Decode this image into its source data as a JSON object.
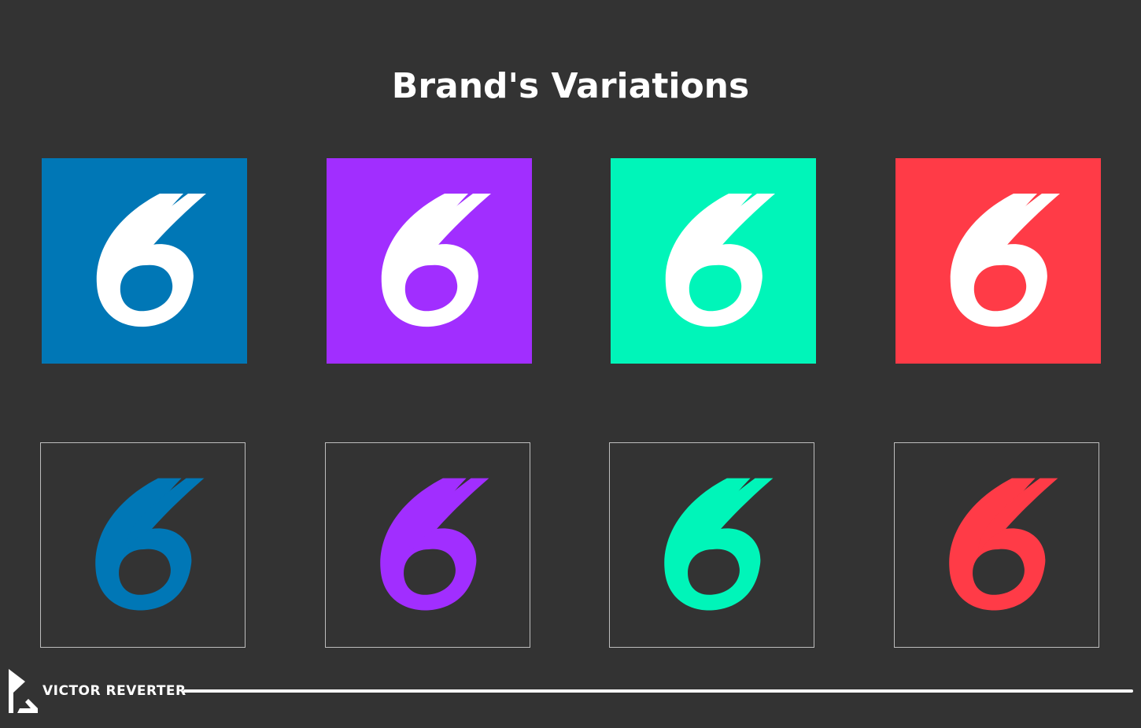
{
  "title": "Brand's Variations",
  "variations": [
    {
      "color": "#0077b6",
      "name": "blue"
    },
    {
      "color": "#a12eff",
      "name": "purple"
    },
    {
      "color": "#00f5b9",
      "name": "mint"
    },
    {
      "color": "#ff3b47",
      "name": "red"
    }
  ],
  "logo_glyph_color_on_fill": "#ffffff",
  "footer": {
    "author": "VICTOR REVERTER",
    "logo_icon": "vr-monogram-icon"
  }
}
